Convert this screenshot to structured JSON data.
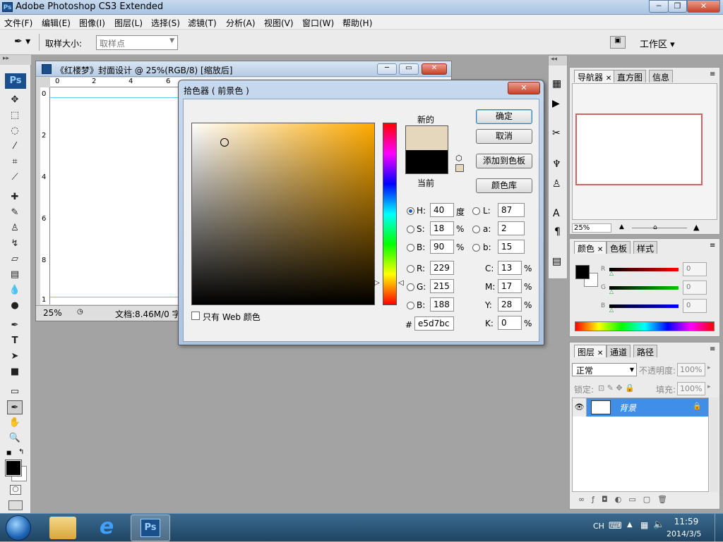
{
  "app": {
    "title": "Adobe Photoshop CS3 Extended",
    "ps_logo": "Ps"
  },
  "menu": [
    "文件(F)",
    "编辑(E)",
    "图像(I)",
    "图层(L)",
    "选择(S)",
    "滤镜(T)",
    "分析(A)",
    "视图(V)",
    "窗口(W)",
    "帮助(H)"
  ],
  "options": {
    "sample_size_label": "取样大小:",
    "sample_size_value": "取样点",
    "workspace_label": "工作区 ▾"
  },
  "document": {
    "title": "《红楼梦》封面设计 @ 25%(RGB/8) [缩放后]",
    "zoom": "25%",
    "docinfo": "文档:8.46M/0 字",
    "ruler_top": [
      "0",
      "2",
      "4",
      "6"
    ],
    "ruler_left": [
      "0",
      "2",
      "4",
      "6",
      "8",
      "1"
    ]
  },
  "picker": {
    "title": "拾色器 ( 前景色 )",
    "new_label": "新的",
    "current_label": "当前",
    "new_color": "#e5d7bc",
    "current_color": "#000000",
    "ok": "确定",
    "cancel": "取消",
    "add_swatch": "添加到色板",
    "color_library": "颜色库",
    "web_only": "只有 Web 颜色",
    "H": {
      "label": "H:",
      "value": "40",
      "unit": "度"
    },
    "S": {
      "label": "S:",
      "value": "18",
      "unit": "%"
    },
    "Bv": {
      "label": "B:",
      "value": "90",
      "unit": "%"
    },
    "R": {
      "label": "R:",
      "value": "229"
    },
    "G": {
      "label": "G:",
      "value": "215"
    },
    "Bb": {
      "label": "B:",
      "value": "188"
    },
    "L": {
      "label": "L:",
      "value": "87"
    },
    "a": {
      "label": "a:",
      "value": "2"
    },
    "b": {
      "label": "b:",
      "value": "15"
    },
    "C": {
      "label": "C:",
      "value": "13",
      "unit": "%"
    },
    "M": {
      "label": "M:",
      "value": "17",
      "unit": "%"
    },
    "Y": {
      "label": "Y:",
      "value": "28",
      "unit": "%"
    },
    "K": {
      "label": "K:",
      "value": "0",
      "unit": "%"
    },
    "hex_label": "#",
    "hex": "e5d7bc",
    "hue_color": "#ffaa00"
  },
  "navigator": {
    "tabs": [
      "导航器",
      "直方图",
      "信息"
    ],
    "zoom": "25%"
  },
  "color_panel": {
    "tabs": [
      "颜色",
      "色板",
      "样式"
    ],
    "R": "0",
    "G": "0",
    "B": "0",
    "r_label": "R",
    "g_label": "G",
    "b_label": "B"
  },
  "layers": {
    "tabs": [
      "图层",
      "通道",
      "路径"
    ],
    "blend_mode": "正常",
    "opacity_label": "不透明度:",
    "opacity": "100%",
    "lock_label": "锁定:",
    "fill_label": "填充:",
    "fill": "100%",
    "layer_name": "背景"
  },
  "taskbar": {
    "lang": "CH",
    "time": "11:59",
    "date": "2014/3/5",
    "start_icon": "windows-orb-icon"
  }
}
